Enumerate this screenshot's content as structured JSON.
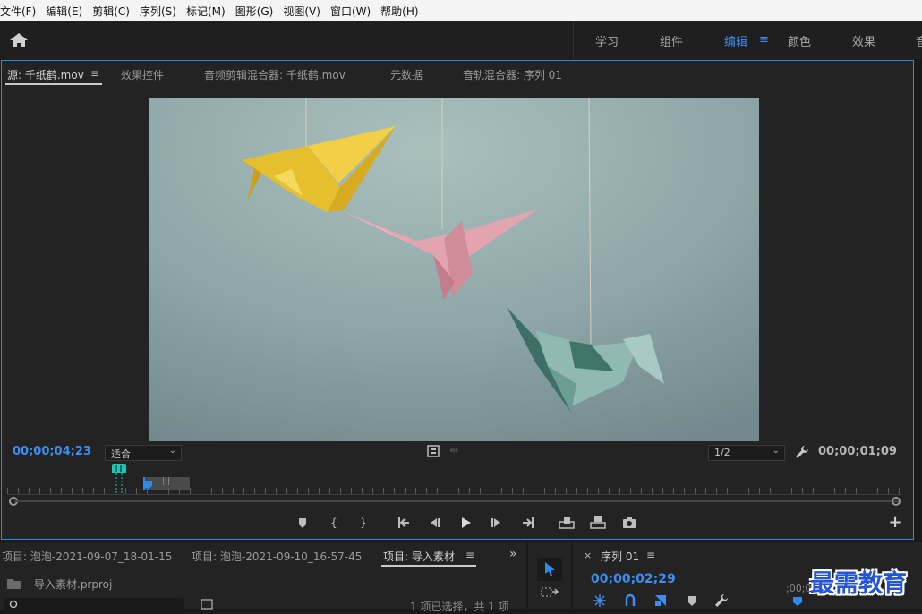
{
  "menubar": {
    "items": [
      "文件(F)",
      "编辑(E)",
      "剪辑(C)",
      "序列(S)",
      "标记(M)",
      "图形(G)",
      "视图(V)",
      "窗口(W)",
      "帮助(H)"
    ]
  },
  "workspaces": {
    "items": [
      "学习",
      "组件",
      "编辑",
      "颜色",
      "效果",
      "音"
    ],
    "active": "编辑"
  },
  "source_panel": {
    "tabs": [
      "源: 千纸鹤.mov",
      "效果控件",
      "音频剪辑混合器: 千纸鹤.mov",
      "元数据",
      "音轨混合器: 序列 01"
    ],
    "active_tab": "源: 千纸鹤.mov",
    "timecode_current": "00;00;04;23",
    "zoom_select": "适合",
    "resolution_select": "1/2",
    "timecode_duration": "00;00;01;09",
    "playhead_fraction": 0.12,
    "in_out_range": [
      0.155,
      0.203
    ]
  },
  "transport": {
    "icons": [
      "marker-icon",
      "mark-in-icon",
      "mark-out-icon",
      "go-to-in-icon",
      "step-back-icon",
      "play-icon",
      "step-forward-icon",
      "go-to-out-icon",
      "insert-icon",
      "overwrite-icon",
      "export-frame-icon",
      "add-button-icon"
    ]
  },
  "project_panel": {
    "tabs": [
      "项目: 泡泡-2021-09-07_18-01-15",
      "项目: 泡泡-2021-09-10_16-57-45",
      "项目: 导入素材"
    ],
    "active_tab": "项目: 导入素材",
    "project_file": "导入素材.prproj",
    "selection_status": "1 项已选择，共 1 项"
  },
  "sequence_panel": {
    "title": "序列 01",
    "timecode": "00;00;02;29",
    "ruler_label": ";00;00"
  },
  "watermark": "最需教育",
  "colors": {
    "accent": "#2d8ceb",
    "timecode": "#3d8ef0",
    "panel": "#232323",
    "playhead": "#19d4c1"
  }
}
